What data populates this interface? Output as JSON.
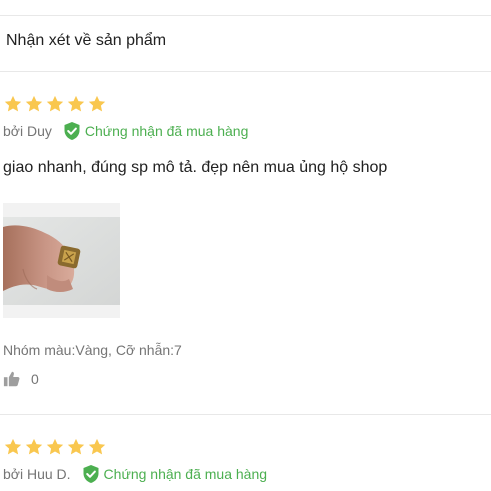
{
  "section": {
    "title": "Nhận xét về sản phẩm"
  },
  "colors": {
    "star": "#f9c74f",
    "verified": "#4caf50",
    "muted": "#757575",
    "divider": "#e8e8e8"
  },
  "reviews": [
    {
      "rating": 5,
      "author": "bởi Duy",
      "verified_label": "Chứng nhận đã mua hàng",
      "text": "giao nhanh, đúng sp mô tả. đẹp nên mua ủng hộ shop",
      "variant": "Nhóm màu:Vàng, Cỡ nhẫn:7",
      "likes": "0",
      "icons": [
        "star-icon",
        "shield-check-icon",
        "thumbs-up-icon"
      ]
    },
    {
      "rating": 5,
      "author": "bởi Huu D.",
      "verified_label": "Chứng nhận đã mua hàng"
    }
  ]
}
